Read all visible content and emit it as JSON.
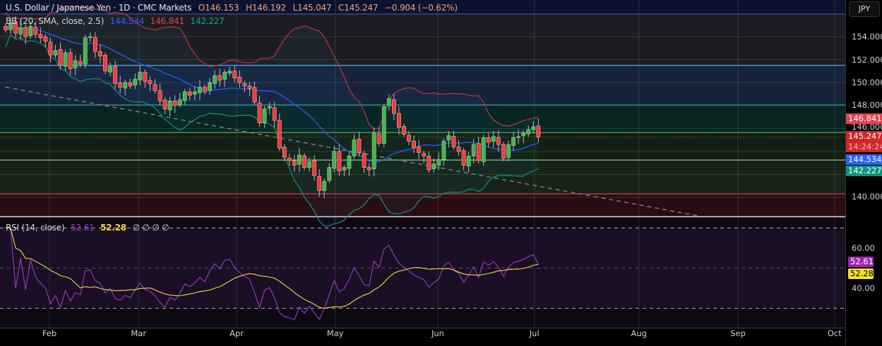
{
  "header": {
    "symbol": "U.S. Dollar / Japanese Yen · 1D · CMC Markets",
    "open": "O146.153",
    "high": "H146.192",
    "low": "L145.047",
    "close": "C145.247",
    "change": "−0.904 (−0.62%)"
  },
  "bb_legend": {
    "label": "BB (20, SMA, close, 2.5)",
    "basis": "144.534",
    "upper": "146.841",
    "lower": "142.227"
  },
  "rsi_legend": {
    "label": "RSI (14, close)",
    "rsi": "52.61",
    "ma": "52.28",
    "extras": "∅ ∅ ∅ ∅"
  },
  "price_axis": {
    "currency": "JPY",
    "ticks": [
      "154.000",
      "152.000",
      "150.000",
      "148.000",
      "146.000",
      "140.000"
    ],
    "badges": {
      "upper": "146.841",
      "last": "145.247",
      "countdown": "14:24:24",
      "basis": "144.534",
      "lower": "142.227"
    }
  },
  "rsi_axis": {
    "ticks": [
      "60.00",
      "40.00"
    ],
    "rsi_badge": "52.61",
    "ma_badge": "52.28"
  },
  "colors": {
    "up": "#4caf50",
    "down": "#f23645",
    "bb_basis": "#2962ff",
    "bb_upper": "#c2343f",
    "bb_lower": "#17907a",
    "rsi": "#9c3cc4",
    "rsi_ma": "#f5d742"
  },
  "chart_data": {
    "type": "candlestick",
    "title": "U.S. Dollar / Japanese Yen · 1D · CMC Markets",
    "ylim": [
      138.3,
      156.0
    ],
    "rsi_ylim": [
      20,
      85
    ],
    "close": [
      154.6,
      155.2,
      154.3,
      154.8,
      154.0,
      154.9,
      154.2,
      153.9,
      153.6,
      152.4,
      152.8,
      151.5,
      152.6,
      151.2,
      151.9,
      151.6,
      153.9,
      154.0,
      152.7,
      152.3,
      151.0,
      151.4,
      149.9,
      149.6,
      150.0,
      149.7,
      150.3,
      150.9,
      150.1,
      149.9,
      149.3,
      148.4,
      147.7,
      148.4,
      148.0,
      148.5,
      149.2,
      148.9,
      149.2,
      149.6,
      149.2,
      150.0,
      150.6,
      150.2,
      150.9,
      151.0,
      150.4,
      150.0,
      149.7,
      149.5,
      148.3,
      146.5,
      147.7,
      147.9,
      146.7,
      144.3,
      143.5,
      143.2,
      142.8,
      143.7,
      142.6,
      143.1,
      141.9,
      140.6,
      141.4,
      142.6,
      144.0,
      142.3,
      142.6,
      143.6,
      145.0,
      143.9,
      142.6,
      142.4,
      145.6,
      144.7,
      147.9,
      148.6,
      147.3,
      146.1,
      145.5,
      144.9,
      144.3,
      143.9,
      143.6,
      142.4,
      142.9,
      143.3,
      144.9,
      145.4,
      144.4,
      144.0,
      142.8,
      143.6,
      144.6,
      143.2,
      145.2,
      144.8,
      145.3,
      144.6,
      143.4,
      144.6,
      145.2,
      145.3,
      145.6,
      145.9,
      146.15,
      145.25
    ],
    "horizontal_levels": [
      155.96,
      151.5,
      148.05,
      145.65,
      143.25,
      140.3
    ],
    "trendline": {
      "from": [
        0,
        149.6
      ],
      "to": [
        139,
        138.4
      ]
    },
    "x_ticks": [
      {
        "label": "Feb",
        "bar": 8.8
      },
      {
        "label": "Mar",
        "bar": 26.7
      },
      {
        "label": "Apr",
        "bar": 46.4
      },
      {
        "label": "May",
        "bar": 66.2
      },
      {
        "label": "Jun",
        "bar": 86.8
      },
      {
        "label": "Jul",
        "bar": 106.2
      },
      {
        "label": "Aug",
        "bar": 127.2
      },
      {
        "label": "Sep",
        "bar": 147.1
      },
      {
        "label": "Oct",
        "bar": 166.5
      }
    ],
    "bb": {
      "length": 20,
      "mult": 2.5
    },
    "rsi": {
      "length": 14,
      "ma_length": 14,
      "bands": [
        70,
        50,
        30
      ]
    }
  }
}
